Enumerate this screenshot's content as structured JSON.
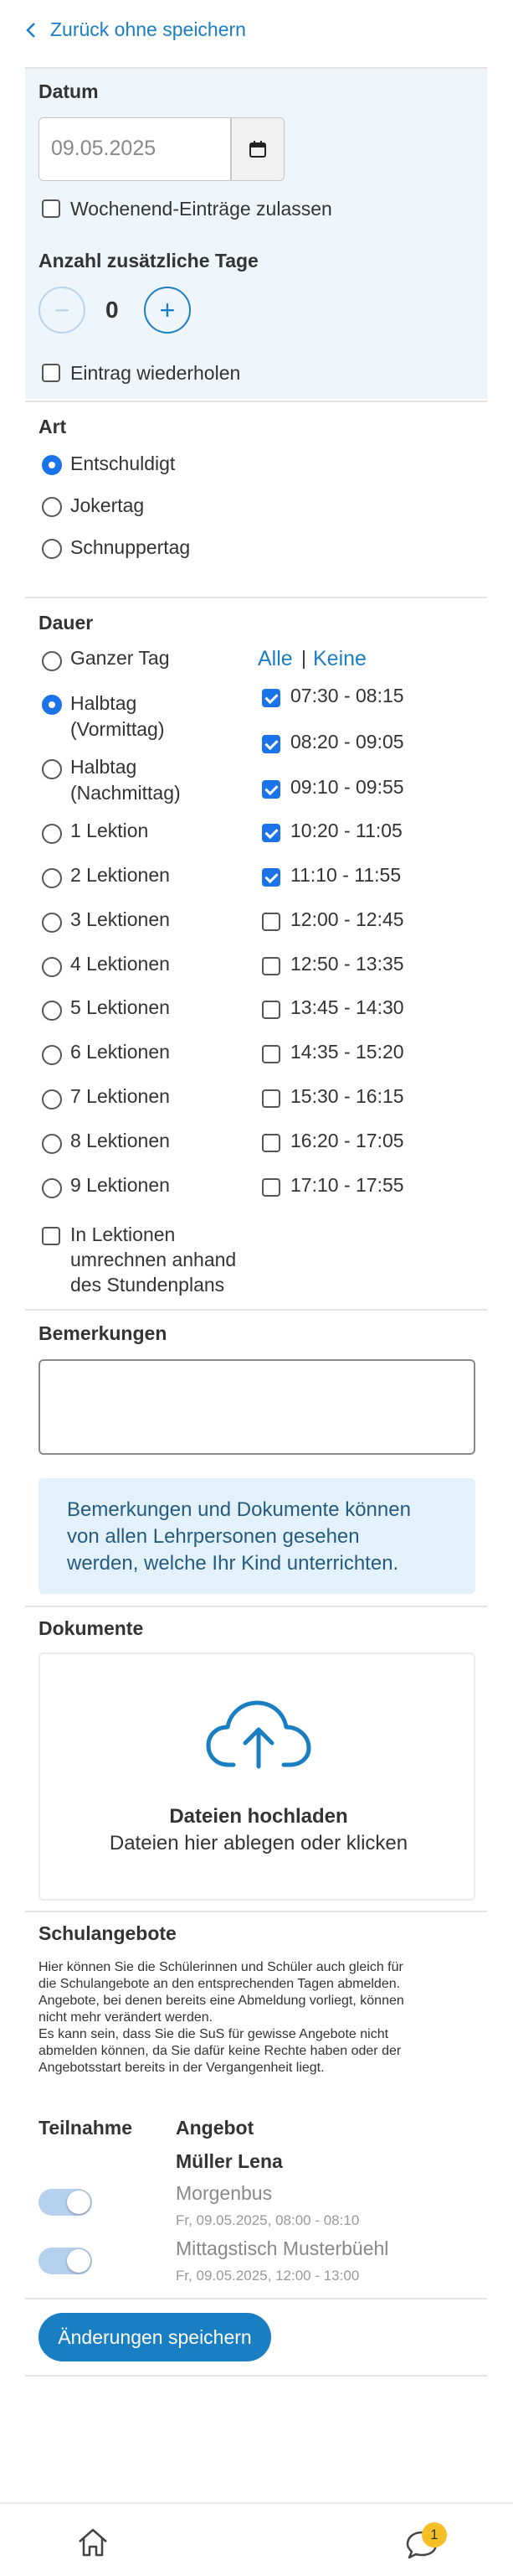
{
  "header": {
    "back_label": "Zurück ohne speichern"
  },
  "datum": {
    "label": "Datum",
    "value": "09.05.2025",
    "weekend_label": "Wochenend-Einträge zulassen",
    "extra_days_label": "Anzahl zusätzliche Tage",
    "extra_days_value": "0",
    "minus": "−",
    "plus": "+",
    "repeat_label": "Eintrag wiederholen"
  },
  "art": {
    "label": "Art",
    "options": [
      "Entschuldigt",
      "Jokertag",
      "Schnuppertag"
    ],
    "selected": "Entschuldigt"
  },
  "dauer": {
    "label": "Dauer",
    "options": [
      "Ganzer Tag",
      "Halbtag (Vormittag)",
      "Halbtag (Nachmittag)",
      "1 Lektion",
      "2 Lektionen",
      "3 Lektionen",
      "4 Lektionen",
      "5 Lektionen",
      "6 Lektionen",
      "7 Lektionen",
      "8 Lektionen",
      "9 Lektionen"
    ],
    "selected": "Halbtag (Vormittag)",
    "all_label": "Alle",
    "separator": "|",
    "none_label": "Keine",
    "lessons": [
      {
        "time": "07:30 - 08:15",
        "checked": true
      },
      {
        "time": "08:20 - 09:05",
        "checked": true
      },
      {
        "time": "09:10 - 09:55",
        "checked": true
      },
      {
        "time": "10:20 - 11:05",
        "checked": true
      },
      {
        "time": "11:10 - 11:55",
        "checked": true
      },
      {
        "time": "12:00 - 12:45",
        "checked": false
      },
      {
        "time": "12:50 - 13:35",
        "checked": false
      },
      {
        "time": "13:45 - 14:30",
        "checked": false
      },
      {
        "time": "14:35 - 15:20",
        "checked": false
      },
      {
        "time": "15:30 - 16:15",
        "checked": false
      },
      {
        "time": "16:20 - 17:05",
        "checked": false
      },
      {
        "time": "17:10 - 17:55",
        "checked": false
      }
    ],
    "convert_label_lines": [
      "In Lektionen",
      "umrechnen anhand",
      "des Stundenplans"
    ]
  },
  "bemerkungen": {
    "label": "Bemerkungen",
    "info_lines": [
      "Bemerkungen und Dokumente können",
      "von allen Lehrpersonen gesehen",
      "werden, welche Ihr Kind unterrichten."
    ]
  },
  "dokumente": {
    "label": "Dokumente",
    "upload_title": "Dateien hochladen",
    "upload_sub": "Dateien hier ablegen oder klicken"
  },
  "schulangebote": {
    "label": "Schulangebote",
    "info_lines": [
      "Hier können Sie die Schülerinnen und Schüler auch gleich für",
      "die Schulangebote an den entsprechenden Tagen abmelden.",
      "Angebote, bei denen bereits eine Abmeldung vorliegt, können",
      "nicht mehr verändert werden.",
      "Es kann sein, dass Sie die SuS für gewisse Angebote nicht",
      "abmelden können, da Sie dafür keine Rechte haben oder der",
      "Angebotsstart bereits in der Vergangenheit liegt."
    ],
    "col_teilnahme": "Teilnahme",
    "col_angebot": "Angebot",
    "student": "Müller Lena",
    "offers": [
      {
        "name": "Morgenbus",
        "when": "Fr, 09.05.2025, 08:00 - 08:10",
        "on": true
      },
      {
        "name": "Mittagstisch Musterbüehl",
        "when": "Fr, 09.05.2025, 12:00 - 13:00",
        "on": true
      }
    ]
  },
  "actions": {
    "save_label": "Änderungen speichern"
  },
  "bottom_nav": {
    "messages_badge": "1"
  },
  "colors": {
    "accent": "#1a7ec2",
    "section_bg": "#eef5fb",
    "info_bg": "#e3f1fa",
    "badge": "#f5c026"
  },
  "icons": [
    "chevron-left-icon",
    "calendar-icon",
    "cloud-upload-icon",
    "home-icon",
    "chat-icon"
  ]
}
